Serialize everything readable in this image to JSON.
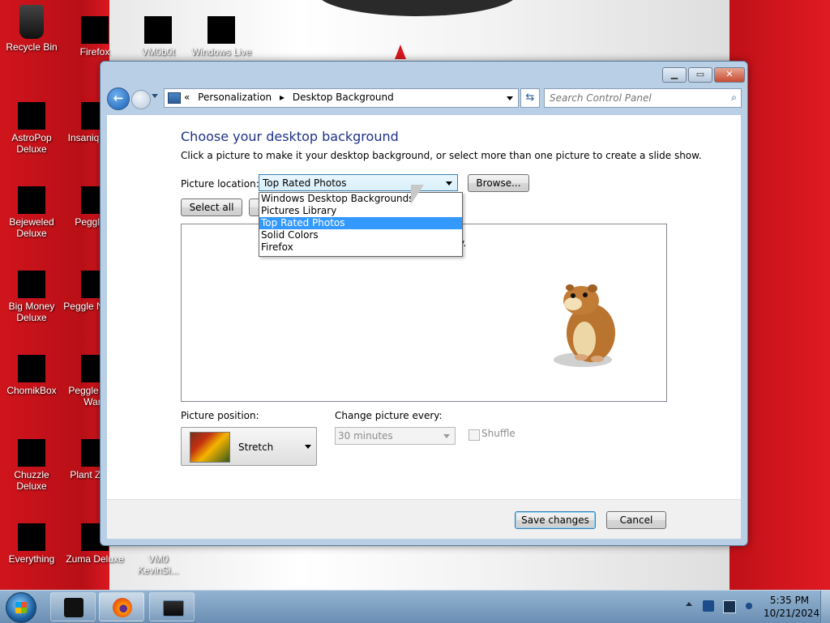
{
  "desktop": {
    "icons": [
      {
        "label": "Recycle Bin",
        "type": "bin"
      },
      {
        "label": "Firefox"
      },
      {
        "label": "VM0b0t"
      },
      {
        "label": "Windows Live"
      },
      {
        "label": "AstroPop Deluxe"
      },
      {
        "label": "Insaniq Delu"
      },
      {
        "label": "Bejeweled Deluxe"
      },
      {
        "label": "Peggle D"
      },
      {
        "label": "Big Money Deluxe"
      },
      {
        "label": "Peggle N Delu"
      },
      {
        "label": "ChomikBox"
      },
      {
        "label": "Peggle W of Warc"
      },
      {
        "label": "Chuzzle Deluxe"
      },
      {
        "label": "Plant Zomb"
      },
      {
        "label": "Everything"
      },
      {
        "label": "Zuma Deluxe"
      },
      {
        "label": "VM0 KevinSi..."
      }
    ]
  },
  "window": {
    "caption": {
      "minimize": "▁",
      "maximize": "▭",
      "close": "✕"
    },
    "address": {
      "prefix": "«",
      "crumbs": [
        "Personalization",
        "▸",
        "Desktop Background"
      ]
    },
    "search": {
      "placeholder": "Search Control Panel"
    },
    "title": "Choose your desktop background",
    "description": "Click a picture to make it your desktop background, or select more than one picture to create a slide show.",
    "picture_location": {
      "label": "Picture location:",
      "value": "Top Rated Photos",
      "options": [
        "Windows Desktop Backgrounds",
        "Pictures Library",
        "Top Rated Photos",
        "Solid Colors",
        "Firefox"
      ],
      "selected_index": 2
    },
    "browse_label": "Browse...",
    "select_all_label": "Select all",
    "picture_area_snippet": "y.",
    "picture_position": {
      "label": "Picture position:",
      "value": "Stretch"
    },
    "change_interval": {
      "label": "Change picture every:",
      "value": "30 minutes"
    },
    "shuffle_label": "Shuffle",
    "save_label": "Save changes",
    "cancel_label": "Cancel"
  },
  "taskbar": {
    "clock_time": "5:35 PM",
    "clock_date": "10/21/2024"
  }
}
